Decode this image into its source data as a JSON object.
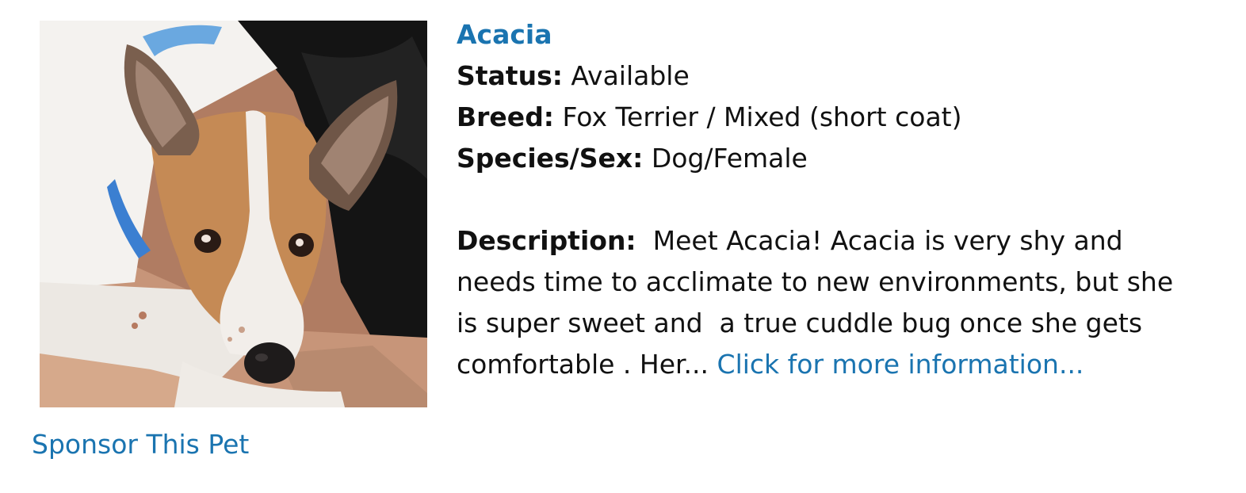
{
  "colors": {
    "link": "#1a74b0",
    "text": "#111111",
    "background": "#ffffff"
  },
  "pet": {
    "photo_alt": "Photo of Acacia",
    "name": "Acacia",
    "status_label": "Status:",
    "status_value": " Available",
    "breed_label": "Breed:",
    "breed_value": " Fox Terrier / Mixed (short coat)",
    "species_label": "Species/Sex:",
    "species_value": " Dog/Female",
    "description_label": "Description:",
    "description_text": "  Meet Acacia! Acacia is very shy and needs time to acclimate to new environments, but she is super sweet and  a true cuddle bug once she gets comfortable . Her... ",
    "more_link": "Click for more information...",
    "sponsor_link": "Sponsor This Pet"
  }
}
